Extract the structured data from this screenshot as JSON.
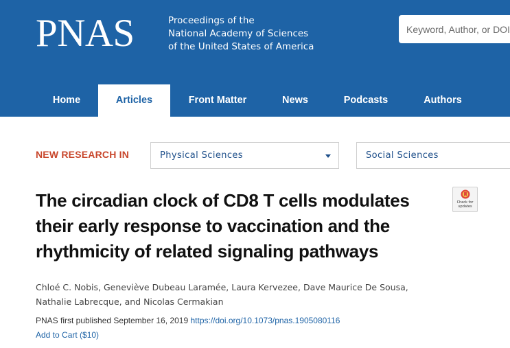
{
  "header": {
    "logo": "PNAS",
    "tagline": [
      "Proceedings of the",
      "National Academy of Sciences",
      "of the United States of America"
    ],
    "search_placeholder": "Keyword, Author, or DOI"
  },
  "nav": {
    "items": [
      {
        "label": "Home",
        "active": false
      },
      {
        "label": "Articles",
        "active": true
      },
      {
        "label": "Front Matter",
        "active": false
      },
      {
        "label": "News",
        "active": false
      },
      {
        "label": "Podcasts",
        "active": false
      },
      {
        "label": "Authors",
        "active": false
      }
    ]
  },
  "new_research": {
    "label": "NEW RESEARCH IN",
    "filters": [
      "Physical Sciences",
      "Social Sciences"
    ]
  },
  "article": {
    "title_lines": [
      "The circadian clock of CD8 T cells modulates",
      "their early response to vaccination and the",
      "rhythmicity of related signaling pathways"
    ],
    "check_updates": [
      "Check for",
      "updates"
    ],
    "authors_lines": [
      "Chloé C. Nobis, Geneviève Dubeau Laramée, Laura Kervezee, Dave Maurice De Sousa,",
      "Nathalie Labrecque, and Nicolas Cermakian"
    ],
    "published": "PNAS first published September 16, 2019",
    "doi": "https://doi.org/10.1073/pnas.1905080116",
    "cart": "Add to Cart ($10)"
  },
  "colors": {
    "header_bg": "#1e63a6",
    "accent_red": "#c8462b",
    "link_blue": "#1e63a6"
  }
}
